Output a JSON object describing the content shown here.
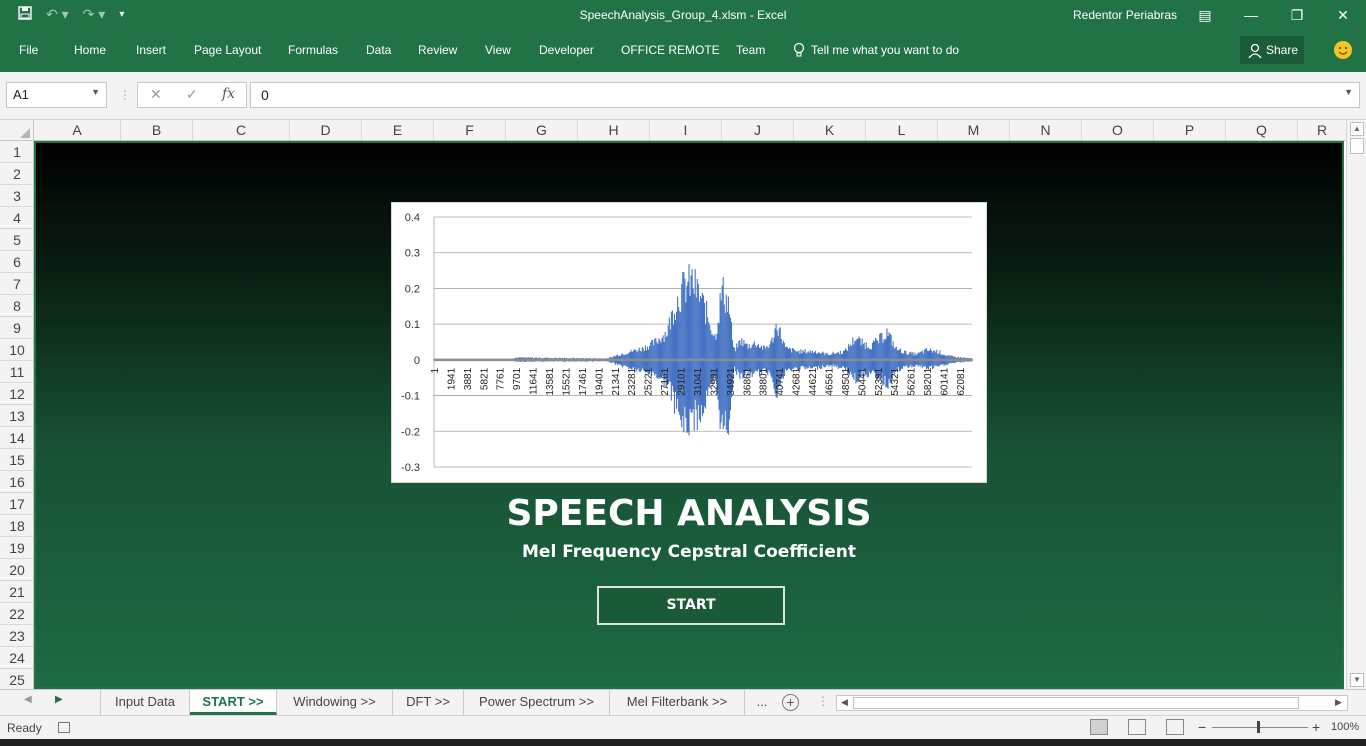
{
  "titlebar": {
    "doc_title": "SpeechAnalysis_Group_4.xlsm  -  Excel",
    "user": "Redentor Periabras"
  },
  "ribbon": {
    "tabs": [
      "File",
      "Home",
      "Insert",
      "Page Layout",
      "Formulas",
      "Data",
      "Review",
      "View",
      "Developer",
      "OFFICE REMOTE",
      "Team"
    ],
    "tell_me": "Tell me what you want to do",
    "share": "Share"
  },
  "formula_bar": {
    "name_box": "A1",
    "fx": "fx",
    "value": "0"
  },
  "columns": [
    "A",
    "B",
    "C",
    "D",
    "E",
    "F",
    "G",
    "H",
    "I",
    "J",
    "K",
    "L",
    "M",
    "N",
    "O",
    "P",
    "Q",
    "R"
  ],
  "rows": [
    "1",
    "2",
    "3",
    "4",
    "5",
    "6",
    "7",
    "8",
    "9",
    "10",
    "11",
    "12",
    "13",
    "14",
    "15",
    "16",
    "17",
    "18",
    "19",
    "20",
    "21",
    "22",
    "23",
    "24",
    "25"
  ],
  "sheet": {
    "title": "SPEECH ANALYSIS",
    "subtitle": "Mel Frequency Cepstral Coefficient",
    "start_button": "START"
  },
  "chart_data": {
    "type": "line",
    "title": "",
    "xlabel": "",
    "ylabel": "",
    "ylim": [
      -0.3,
      0.4
    ],
    "y_ticks": [
      "0.4",
      "0.3",
      "0.2",
      "0.1",
      "0",
      "-0.1",
      "-0.2",
      "-0.3"
    ],
    "x_tick_labels": [
      "1",
      "1941",
      "3881",
      "5821",
      "7761",
      "9701",
      "11641",
      "13581",
      "15521",
      "17461",
      "19401",
      "21341",
      "23281",
      "25221",
      "27161",
      "29101",
      "31041",
      "32981",
      "34921",
      "36861",
      "38801",
      "40741",
      "42681",
      "44621",
      "46561",
      "48501",
      "50441",
      "52381",
      "54321",
      "56261",
      "58201",
      "60141",
      "62081"
    ],
    "x_range": [
      1,
      63500
    ],
    "series_color": "#4472c4",
    "grid": true,
    "envelope": {
      "x": [
        1,
        9000,
        9800,
        20500,
        22000,
        24500,
        26000,
        27500,
        28500,
        29500,
        30500,
        31500,
        32500,
        33200,
        34000,
        34800,
        35400,
        36200,
        37000,
        38000,
        39000,
        39800,
        40500,
        41500,
        43000,
        45000,
        46500,
        48500,
        49800,
        50500,
        51500,
        52500,
        53500,
        54500,
        55800,
        57000,
        58200,
        59500,
        60500,
        61500,
        63500
      ],
      "pos": [
        0.003,
        0.003,
        0.008,
        0.005,
        0.02,
        0.04,
        0.06,
        0.1,
        0.2,
        0.26,
        0.28,
        0.22,
        0.14,
        0.08,
        0.25,
        0.2,
        0.03,
        0.07,
        0.05,
        0.06,
        0.04,
        0.06,
        0.13,
        0.04,
        0.03,
        0.03,
        0.02,
        0.03,
        0.08,
        0.06,
        0.05,
        0.07,
        0.1,
        0.04,
        0.025,
        0.02,
        0.035,
        0.03,
        0.015,
        0.01,
        0.005
      ],
      "neg": [
        -0.003,
        -0.003,
        -0.006,
        -0.005,
        -0.02,
        -0.04,
        -0.05,
        -0.08,
        -0.16,
        -0.24,
        -0.21,
        -0.19,
        -0.12,
        -0.07,
        -0.25,
        -0.22,
        -0.03,
        -0.06,
        -0.05,
        -0.05,
        -0.04,
        -0.05,
        -0.12,
        -0.04,
        -0.03,
        -0.03,
        -0.02,
        -0.03,
        -0.07,
        -0.05,
        -0.05,
        -0.06,
        -0.09,
        -0.04,
        -0.025,
        -0.02,
        -0.03,
        -0.025,
        -0.015,
        -0.01,
        -0.005
      ]
    }
  },
  "sheet_tabs": [
    "Input Data",
    "START >>",
    "Windowing >>",
    "DFT >>",
    "Power Spectrum >>",
    "Mel Filterbank >>",
    "..."
  ],
  "active_tab": "START >>",
  "statusbar": {
    "status": "Ready",
    "zoom": "100%"
  }
}
